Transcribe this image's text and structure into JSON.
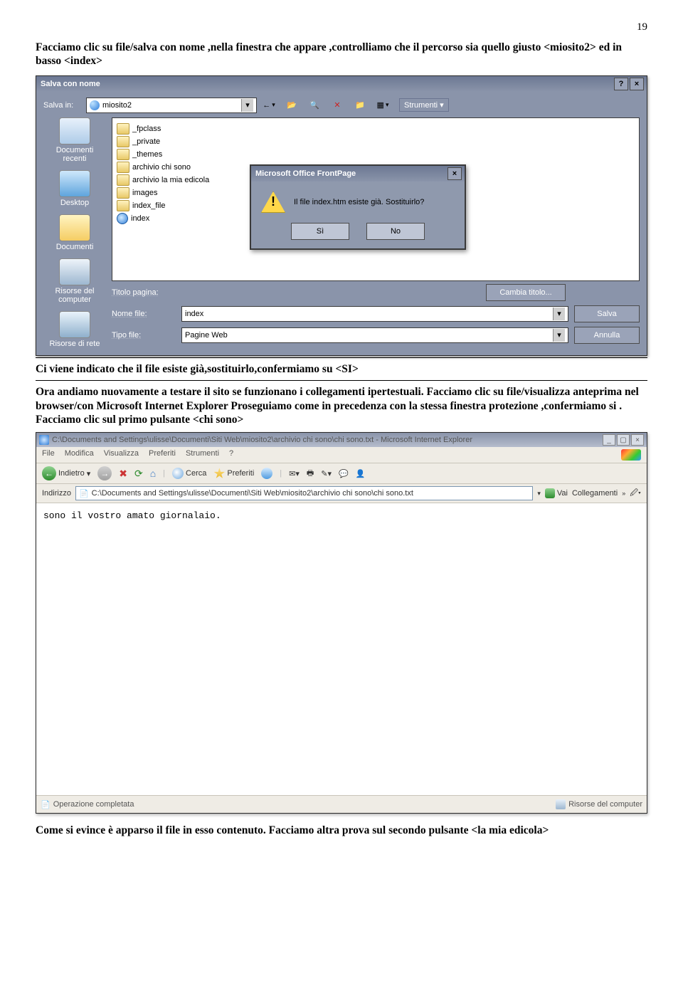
{
  "page_number": "19",
  "para1": "Facciamo clic su file/salva con nome ,nella finestra che appare ,controlliamo che il percorso sia quello giusto <miosito2> ed in basso <index>",
  "save_dialog": {
    "title": "Salva con nome",
    "salva_in_label": "Salva in:",
    "salva_in_value": "miosito2",
    "strumenti_label": "Strumenti",
    "places": {
      "recent": "Documenti recenti",
      "desktop": "Desktop",
      "documents": "Documenti",
      "computer": "Risorse del computer",
      "network": "Risorse di rete"
    },
    "files": [
      "_fpclass",
      "_private",
      "_themes",
      "archivio chi sono",
      "archivio la mia edicola",
      "images",
      "index_file",
      "index"
    ],
    "titolo_pagina_label": "Titolo pagina:",
    "cambia_titolo_btn": "Cambia titolo...",
    "nome_file_label": "Nome file:",
    "nome_file_value": "index",
    "tipo_file_label": "Tipo file:",
    "tipo_file_value": "Pagine Web",
    "salva_btn": "Salva",
    "annulla_btn": "Annulla"
  },
  "confirm": {
    "title": "Microsoft Office FrontPage",
    "message": "Il file index.htm esiste già. Sostituirlo?",
    "yes": "Sì",
    "no": "No"
  },
  "para2": "Ci viene indicato che il file esiste già,sostituirlo,confermiamo su <SI>",
  "para3": " Ora andiamo nuovamente a testare il sito se funzionano i collegamenti ipertestuali. Facciamo clic su file/visualizza anteprima nel browser/con Microsoft Internet Explorer Proseguiamo come in precedenza con la stessa finestra protezione ,confermiamo si . Facciamo clic sul primo pulsante <chi sono>",
  "ie": {
    "title": "C:\\Documents and Settings\\ulisse\\Documenti\\Siti Web\\miosito2\\archivio chi sono\\chi sono.txt - Microsoft Internet Explorer",
    "menu": [
      "File",
      "Modifica",
      "Visualizza",
      "Preferiti",
      "Strumenti",
      "?"
    ],
    "back": "Indietro",
    "search": "Cerca",
    "favorites": "Preferiti",
    "address_label": "Indirizzo",
    "address_value": "C:\\Documents and Settings\\ulisse\\Documenti\\Siti Web\\miosito2\\archivio chi sono\\chi sono.txt",
    "go": "Vai",
    "links": "Collegamenti",
    "content": "sono il vostro amato giornalaio.",
    "status_left": "Operazione completata",
    "status_right": "Risorse del computer"
  },
  "para4": "Come si evince è apparso il file in esso contenuto. Facciamo altra prova sul secondo pulsante <la mia edicola>"
}
